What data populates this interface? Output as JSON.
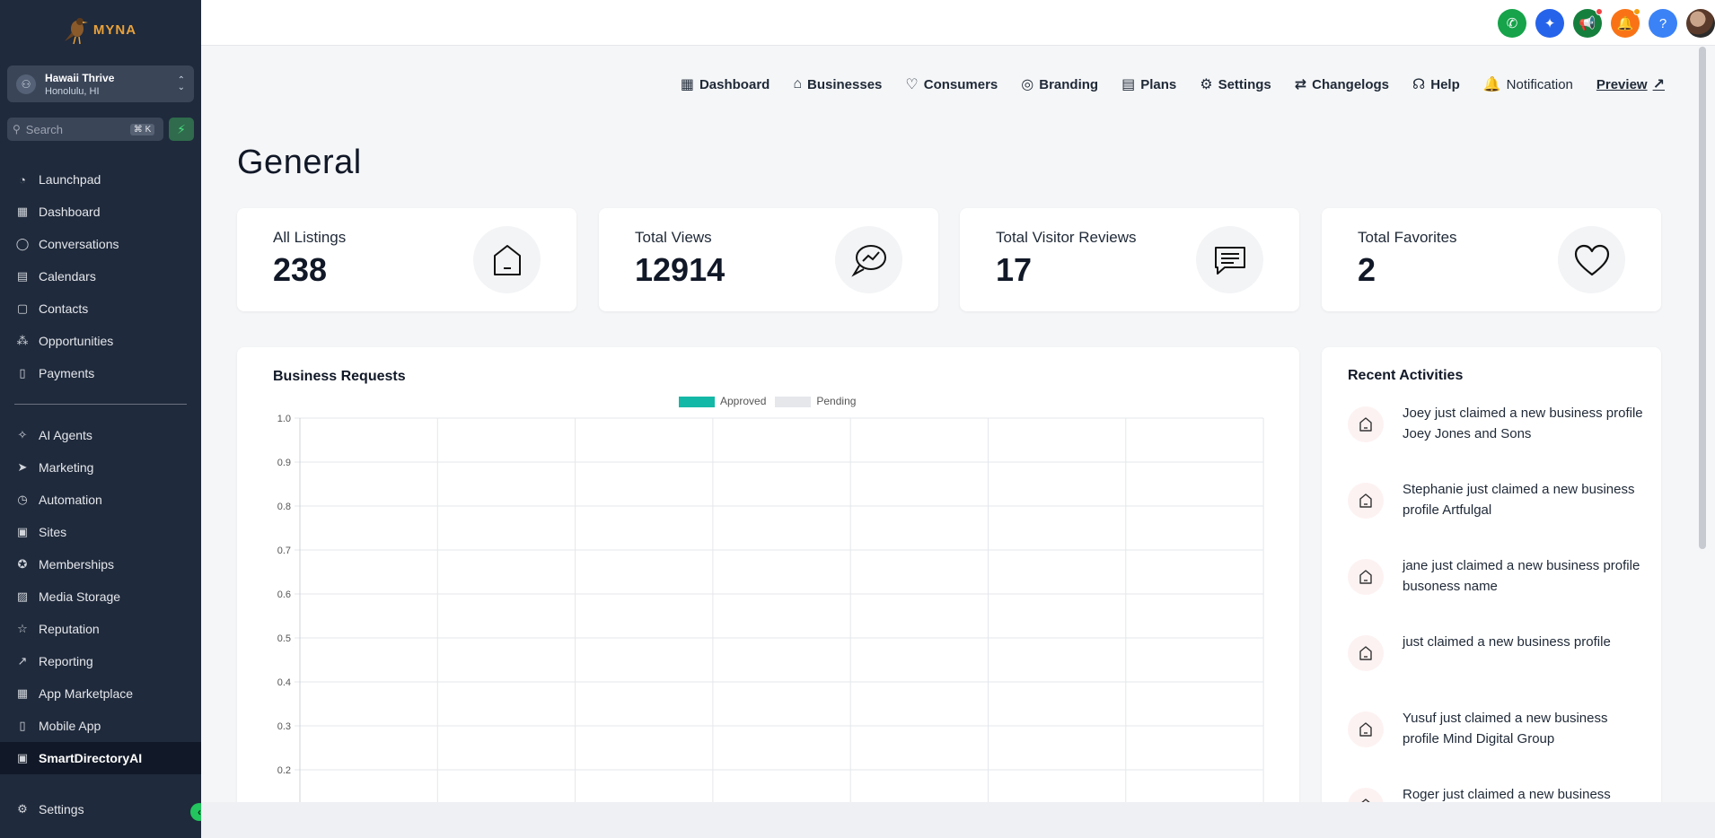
{
  "brand": {
    "name": "MYNA"
  },
  "location": {
    "name": "Hawaii Thrive",
    "city": "Honolulu, HI"
  },
  "search": {
    "placeholder": "Search",
    "shortcut": "⌘ K"
  },
  "sidebar": {
    "primary": [
      {
        "label": "Launchpad",
        "icon": "launchpad-icon"
      },
      {
        "label": "Dashboard",
        "icon": "grid-icon"
      },
      {
        "label": "Conversations",
        "icon": "chat-icon"
      },
      {
        "label": "Calendars",
        "icon": "calendar-icon"
      },
      {
        "label": "Contacts",
        "icon": "contacts-icon"
      },
      {
        "label": "Opportunities",
        "icon": "opportunities-icon"
      },
      {
        "label": "Payments",
        "icon": "payments-icon"
      }
    ],
    "secondary": [
      {
        "label": "AI Agents",
        "icon": "ai-agents-icon"
      },
      {
        "label": "Marketing",
        "icon": "send-icon"
      },
      {
        "label": "Automation",
        "icon": "automation-icon"
      },
      {
        "label": "Sites",
        "icon": "sites-icon"
      },
      {
        "label": "Memberships",
        "icon": "award-icon"
      },
      {
        "label": "Media Storage",
        "icon": "image-icon"
      },
      {
        "label": "Reputation",
        "icon": "star-icon"
      },
      {
        "label": "Reporting",
        "icon": "trend-icon"
      },
      {
        "label": "App Marketplace",
        "icon": "apps-icon"
      },
      {
        "label": "Mobile App",
        "icon": "mobile-icon"
      },
      {
        "label": "SmartDirectoryAI",
        "icon": "directory-icon",
        "active": true
      }
    ],
    "settings_label": "Settings"
  },
  "topnav": {
    "dashboard": "Dashboard",
    "businesses": "Businesses",
    "consumers": "Consumers",
    "branding": "Branding",
    "plans": "Plans",
    "settings": "Settings",
    "changelogs": "Changelogs",
    "help": "Help",
    "notification": "Notification",
    "preview": "Preview"
  },
  "page": {
    "title": "General"
  },
  "stats": [
    {
      "label": "All Listings",
      "value": "238",
      "icon": "house-icon"
    },
    {
      "label": "Total Views",
      "value": "12914",
      "icon": "views-trend-icon"
    },
    {
      "label": "Total Visitor Reviews",
      "value": "17",
      "icon": "reviews-icon"
    },
    {
      "label": "Total Favorites",
      "value": "2",
      "icon": "heart-icon"
    }
  ],
  "chart_data": {
    "type": "bar",
    "title": "Business Requests",
    "series": [
      {
        "name": "Approved",
        "color": "#14b8a6",
        "values": []
      },
      {
        "name": "Pending",
        "color": "#e5e7eb",
        "values": []
      }
    ],
    "categories": [],
    "ylim": [
      0,
      1.0
    ],
    "yticks": [
      "1.0",
      "0.9",
      "0.8",
      "0.7",
      "0.6",
      "0.5",
      "0.4",
      "0.3",
      "0.2"
    ],
    "grid": true,
    "legend": "top-center"
  },
  "activities": {
    "title": "Recent Activities",
    "items": [
      "Joey just claimed a new business profile Joey Jones and Sons",
      "Stephanie just claimed a new business profile Artfulgal",
      "jane just claimed a new business profile busoness name",
      "just claimed a new business profile",
      "Yusuf just claimed a new business profile Mind Digital Group",
      "Roger just claimed a new business"
    ]
  },
  "colors": {
    "sidebar": "#1f2a3c",
    "accent": "#14b8a6",
    "phone": "#16a34a",
    "magic": "#2563eb",
    "announce": "#15803d",
    "bell": "#f97316",
    "help": "#3b82f6"
  }
}
